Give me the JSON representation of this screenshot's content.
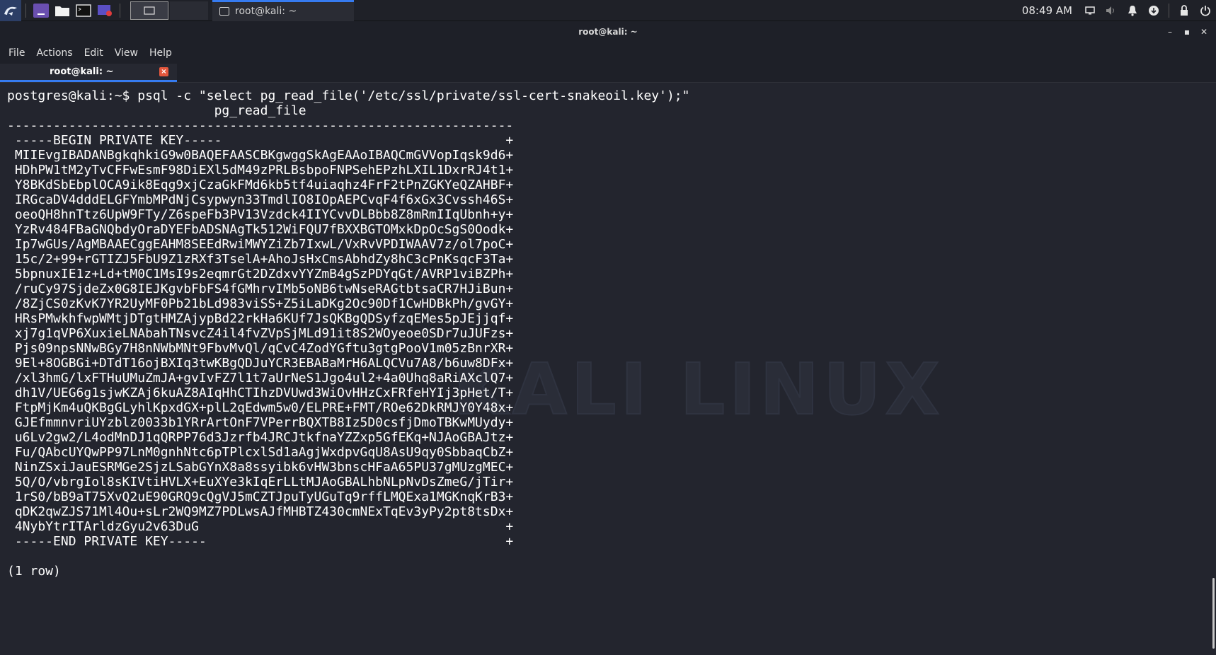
{
  "panel": {
    "workspace_labels": [
      "",
      ""
    ],
    "task_title": "root@kali: ~",
    "clock": "08:49 AM",
    "icons": [
      "kali-dragon-icon",
      "purple-app-icon",
      "file-manager-icon",
      "terminal-icon",
      "screen-recorder-icon",
      "display-icon",
      "volume-icon",
      "bell-icon",
      "download-icon",
      "lock-icon",
      "power-icon"
    ]
  },
  "window": {
    "title": "root@kali: ~",
    "controls": {
      "minimize": "–",
      "maximize": "▪",
      "close": "✕"
    }
  },
  "menu": {
    "file": "File",
    "actions": "Actions",
    "edit": "Edit",
    "view": "View",
    "help": "Help"
  },
  "tab": {
    "label": "root@kali: ~",
    "close": "×"
  },
  "terminal": {
    "watermark": "KALI LINUX",
    "lines": [
      "postgres@kali:~$ psql -c \"select pg_read_file('/etc/ssl/private/ssl-cert-snakeoil.key');\"",
      "                           pg_read_file",
      "------------------------------------------------------------------",
      " -----BEGIN PRIVATE KEY-----                                     +",
      " MIIEvgIBADANBgkqhkiG9w0BAQEFAASCBKgwggSkAgEAAoIBAQCmGVVopIqsk9d6+",
      " HDhPW1tM2yTvCFFwEsmF98DiEXl5dM49zPRLBsbpoFNPSehEPzhLXIL1DxrRJ4t1+",
      " Y8BKdSbEbplOCA9ik8Eqg9xjCzaGkFMd6kb5tf4uiaqhz4FrF2tPnZGKYeQZAHBF+",
      " IRGcaDV4dddELGFYmbMPdNjCsypwyn33TmdlIO8IOpAEPCvqF4f6xGx3Cvssh46S+",
      " oeoQH8hnTtz6UpW9FTy/Z6speFb3PV13Vzdck4IIYCvvDLBbb8Z8mRmIIqUbnh+y+",
      " YzRv484FBaGNQbdyOraDYEFbADSNAgTk512WiFQU7fBXXBGTOMxkDpOcSgS0Oodk+",
      " Ip7wGUs/AgMBAAECggEAHM8SEEdRwiMWYZiZb7IxwL/VxRvVPDIWAAV7z/ol7poC+",
      " 15c/2+99+rGTIZJ5FbU9Z1zRXf3TselA+AhoJsHxCmsAbhdZy8hC3cPnKsqcF3Ta+",
      " 5bpnuxIE1z+Ld+tM0C1MsI9s2eqmrGt2DZdxvYYZmB4gSzPDYqGt/AVRP1viBZPh+",
      " /ruCy97SjdeZx0G8IEJKgvbFbFS4fGMhrvIMb5oNB6twNseRAGtbtsaCR7HJiBun+",
      " /8ZjCS0zKvK7YR2UyMF0Pb21bLd983viSS+Z5iLaDKg2Oc90Df1CwHDBkPh/gvGY+",
      " HRsPMwkhfwpWMtjDTgtHMZAjypBd22rkHa6KUf7JsQKBgQDSyfzqEMes5pJEjjqf+",
      " xj7g1qVP6XuxieLNAbahTNsvcZ4il4fvZVpSjMLd91it8S2WOyeoe0SDr7uJUFzs+",
      " Pjs09npsNNwBGy7H8nNWbMNt9FbvMvQl/qCvC4ZodYGftu3gtgPooV1m05zBnrXR+",
      " 9El+8OGBGi+DTdT16ojBXIq3twKBgQDJuYCR3EBABaMrH6ALQCVu7A8/b6uw8DFx+",
      " /xl3hmG/lxFTHuUMuZmJA+gvIvFZ7l1t7aUrNeS1Jgo4ul2+4a0Uhq8aRiAXclQ7+",
      " dh1V/UEG6g1sjwKZAj6kuAZ8AIqHhCTIhzDVUwd3WiOvHHzCxFRfeHYIj3pHet/T+",
      " FtpMjKm4uQKBgGLyhlKpxdGX+plL2qEdwm5w0/ELPRE+FMT/ROe62DkRMJY0Y48x+",
      " GJEfmmnvriUYzblz0033b1YRrArtOnF7VPerrBQXTB8Iz5D0csfjDmoTBKwMUydy+",
      " u6Lv2gw2/L4odMnDJ1qQRPP76d3Jzrfb4JRCJtkfnaYZZxp5GfEKq+NJAoGBAJtz+",
      " Fu/QAbcUYQwPP97LnM0gnhNtc6pTPlcxlSd1aAgjWxdpvGqU8AsU9qy0SbbaqCbZ+",
      " NinZSxiJauESRMGe2SjzLSabGYnX8a8ssyibk6vHW3bnscHFaA65PU37gMUzgMEC+",
      " 5Q/O/vbrgIol8sKIVtiHVLX+EuXYe3kIqErLLtMJAoGBALhbNLpNvDsZmeG/jTir+",
      " 1rS0/bB9aT75XvQ2uE90GRQ9cQgVJ5mCZTJpuTyUGuTq9rffLMQExa1MGKnqKrB3+",
      " qDK2qwZJS71Ml4Ou+sLr2WQ9MZ7PDLwsAJfMHBTZ430cmNExTqEv3yPy2pt8tsDx+",
      " 4NybYtrITArldzGyu2v63DuG                                        +",
      " -----END PRIVATE KEY-----                                       +",
      "",
      "(1 row)"
    ]
  },
  "colors": {
    "accent": "#367bf0",
    "background": "#23252e",
    "close_tab": "#e4573d"
  }
}
